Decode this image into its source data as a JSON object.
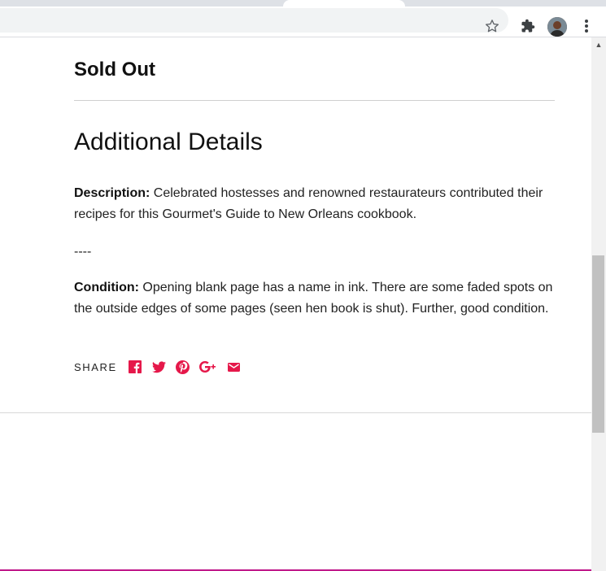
{
  "browser": {
    "icons": [
      "star-icon",
      "puzzle-extension-icon",
      "profile-avatar",
      "kebab-menu-icon"
    ]
  },
  "product": {
    "availability": "Sold Out",
    "details_heading": "Additional Details",
    "description_label": "Description:",
    "description_text": " Celebrated hostesses and renowned restaurateurs contributed their recipes for this Gourmet's Guide to New Orleans cookbook.",
    "separator": "----",
    "condition_label": "Condition:",
    "condition_text": " Opening blank page has a name in ink. There are some faded spots on the outside edges of some pages (seen hen book is shut). Further, good condition."
  },
  "share": {
    "label": "SHARE",
    "icons": [
      "facebook-icon",
      "twitter-icon",
      "pinterest-icon",
      "google-plus-icon",
      "email-icon"
    ],
    "accent_color": "#e5184a"
  }
}
